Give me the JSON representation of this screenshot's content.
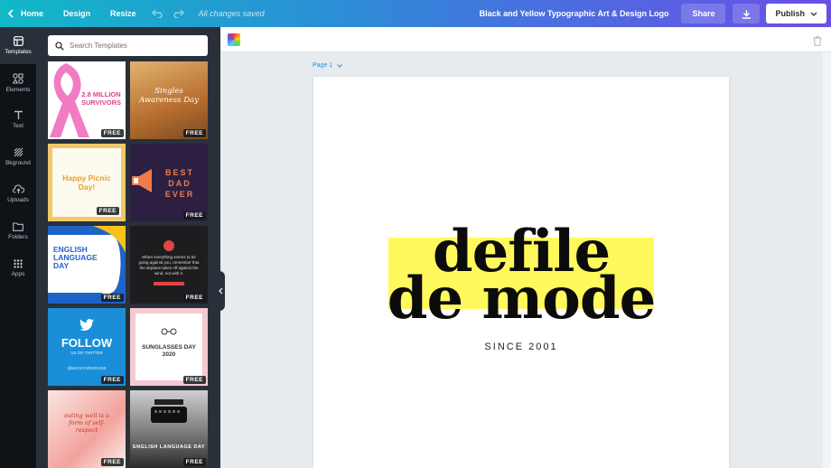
{
  "topbar": {
    "home": "Home",
    "design": "Design",
    "resize": "Resize",
    "saved_status": "All changes saved",
    "doc_title": "Black and Yellow Typographic Art & Design Logo",
    "share": "Share",
    "publish": "Publish"
  },
  "rail": {
    "items": [
      {
        "label": "Templates",
        "icon": "templates-icon"
      },
      {
        "label": "Elements",
        "icon": "elements-icon"
      },
      {
        "label": "Text",
        "icon": "text-icon"
      },
      {
        "label": "Bkground",
        "icon": "background-icon"
      },
      {
        "label": "Uploads",
        "icon": "uploads-icon"
      },
      {
        "label": "Folders",
        "icon": "folders-icon"
      },
      {
        "label": "Apps",
        "icon": "apps-icon"
      }
    ]
  },
  "panel": {
    "search_placeholder": "Search Templates",
    "badge": "FREE",
    "templates": [
      {
        "text": "2.8 MILLION SURVIVORS"
      },
      {
        "text": "Singles Awareness Day"
      },
      {
        "text": "Happy Picnic Day!"
      },
      {
        "text": "BEST DAD EVER"
      },
      {
        "text": "ENGLISH LANGUAGE DAY"
      },
      {
        "text": "When everything seems to be going against you, remember that the airplane takes off against the wind, not with it."
      },
      {
        "text": "FOLLOW",
        "subtext": "US ON TWITTER",
        "handle": "@BACKYARDIGANS"
      },
      {
        "text": "SUNGLASSES DAY 2020"
      },
      {
        "text": "eating well is a form of self-respect"
      },
      {
        "text": "ENGLISH LANGUAGE DAY"
      }
    ]
  },
  "canvas": {
    "page_label": "Page 1",
    "line1": "defile",
    "line2": "de mode",
    "since": "SINCE 2001"
  },
  "colors": {
    "accent": "#fff95e",
    "panel": "#293039",
    "rail": "#0e1318"
  }
}
